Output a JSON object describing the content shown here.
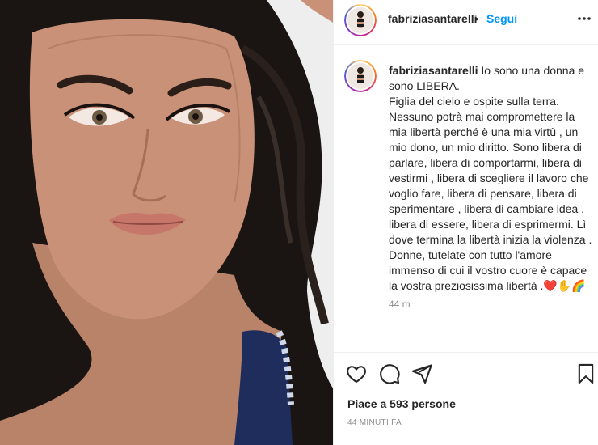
{
  "post": {
    "username": "fabriziasantarelli",
    "separator": "•",
    "follow_label": "Segui"
  },
  "caption": {
    "username": "fabriziasantarelli",
    "lines": [
      "Io sono una donna e",
      "sono LIBERA.",
      "Figlia del cielo e ospite sulla terra.",
      "Nessuno potrà mai compromettere la",
      "mia libertà perché è una mia virtù , un",
      "mio dono, un mio diritto. Sono libera di",
      "parlare, libera di comportarmi, libera di",
      "vestirmi , libera di scegliere il lavoro che",
      "voglio fare, libera di pensare, libera di",
      "sperimentare , libera di cambiare idea ,",
      "libera di essere, libera di esprimermi. Lì",
      "dove termina la libertà inizia la violenza .",
      "Donne, tutelate con tutto l'amore",
      "immenso di cui il vostro cuore è capace",
      "la vostra preziosissima libertà .❤️✋🌈"
    ],
    "time": "44 m"
  },
  "stats": {
    "likes": "Piace a 593 persone",
    "date": "44 MINUTI FA"
  },
  "icons": {
    "more": "more-options-icon",
    "like": "heart-icon",
    "comment": "comment-icon",
    "share": "share-icon",
    "save": "bookmark-icon"
  },
  "colors": {
    "follow": "#0095f6",
    "secondary_text": "#8e8e8e",
    "border": "#efefef"
  }
}
